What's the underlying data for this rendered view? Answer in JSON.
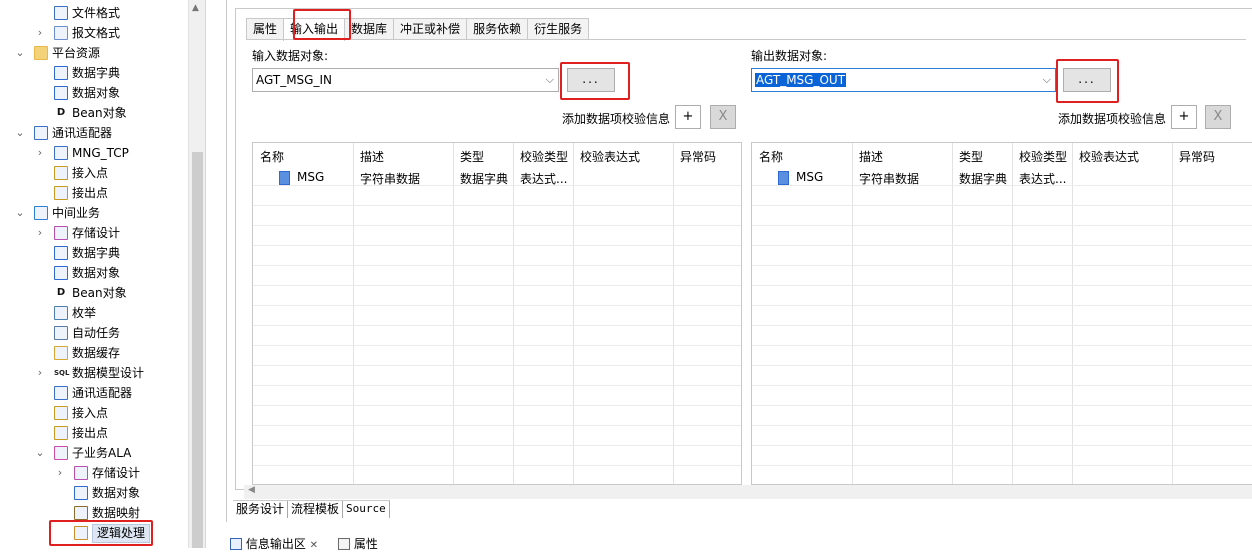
{
  "tree": {
    "items": [
      {
        "label": "文件格式",
        "icon": "file-format-icon",
        "expand": ""
      },
      {
        "label": "报文格式",
        "icon": "message-format-icon",
        "expand": "›"
      },
      {
        "label": "平台资源",
        "icon": "folder-icon",
        "expand": "⌄"
      },
      {
        "label": "数据字典",
        "icon": "data-dictionary-icon",
        "expand": ""
      },
      {
        "label": "数据对象",
        "icon": "data-object-icon",
        "expand": ""
      },
      {
        "label": "Bean对象",
        "icon": "bean-object-icon",
        "expand": ""
      },
      {
        "label": "通讯适配器",
        "icon": "adapter-icon",
        "expand": "⌄"
      },
      {
        "label": "MNG_TCP",
        "icon": "adapter-icon",
        "expand": "›"
      },
      {
        "label": "接入点",
        "icon": "access-point-icon",
        "expand": ""
      },
      {
        "label": "接出点",
        "icon": "exit-point-icon",
        "expand": ""
      },
      {
        "label": "中间业务",
        "icon": "business-icon",
        "expand": "⌄"
      },
      {
        "label": "存储设计",
        "icon": "storage-design-icon",
        "expand": "›"
      },
      {
        "label": "数据字典",
        "icon": "data-dictionary-icon",
        "expand": ""
      },
      {
        "label": "数据对象",
        "icon": "data-object-icon",
        "expand": ""
      },
      {
        "label": "Bean对象",
        "icon": "bean-object-icon",
        "expand": ""
      },
      {
        "label": "枚举",
        "icon": "enum-icon",
        "expand": ""
      },
      {
        "label": "自动任务",
        "icon": "auto-task-icon",
        "expand": ""
      },
      {
        "label": "数据缓存",
        "icon": "data-cache-icon",
        "expand": ""
      },
      {
        "label": "数据模型设计",
        "icon": "sql-model-icon",
        "expand": "›"
      },
      {
        "label": "通讯适配器",
        "icon": "adapter-icon",
        "expand": ""
      },
      {
        "label": "接入点",
        "icon": "access-point-icon",
        "expand": ""
      },
      {
        "label": "接出点",
        "icon": "exit-point-icon",
        "expand": ""
      },
      {
        "label": "子业务ALA",
        "icon": "sub-business-icon",
        "expand": "⌄"
      },
      {
        "label": "存储设计",
        "icon": "storage-design-icon",
        "expand": "›"
      },
      {
        "label": "数据对象",
        "icon": "data-object-icon",
        "expand": ""
      },
      {
        "label": "数据映射",
        "icon": "data-mapping-icon",
        "expand": ""
      },
      {
        "label": "逻辑处理",
        "icon": "logic-process-icon",
        "expand": ""
      }
    ]
  },
  "tabs": [
    "属性",
    "输入输出",
    "数据库",
    "冲正或补偿",
    "服务依赖",
    "衍生服务"
  ],
  "active_tab": "输入输出",
  "input": {
    "label": "输入数据对象:",
    "value": "AGT_MSG_IN",
    "browse": "...",
    "validation_label": "添加数据项校验信息",
    "add": "+",
    "remove": "X"
  },
  "output": {
    "label": "输出数据对象:",
    "value": "AGT_MSG_OUT",
    "browse": "...",
    "validation_label": "添加数据项校验信息",
    "add": "+",
    "remove": "X"
  },
  "table": {
    "columns": [
      "名称",
      "描述",
      "类型",
      "校验类型",
      "校验表达式",
      "异常码"
    ],
    "input_rows": [
      [
        "MSG",
        "字符串数据",
        "数据字典",
        "表达式...",
        "",
        ""
      ]
    ],
    "output_rows": [
      [
        "MSG",
        "字符串数据",
        "数据字典",
        "表达式...",
        "",
        ""
      ]
    ]
  },
  "bottom_tabs": [
    "服务设计",
    "流程模板",
    "Source"
  ],
  "status_bar": {
    "console": "信息输出区",
    "close": "✕",
    "properties": "属性"
  }
}
